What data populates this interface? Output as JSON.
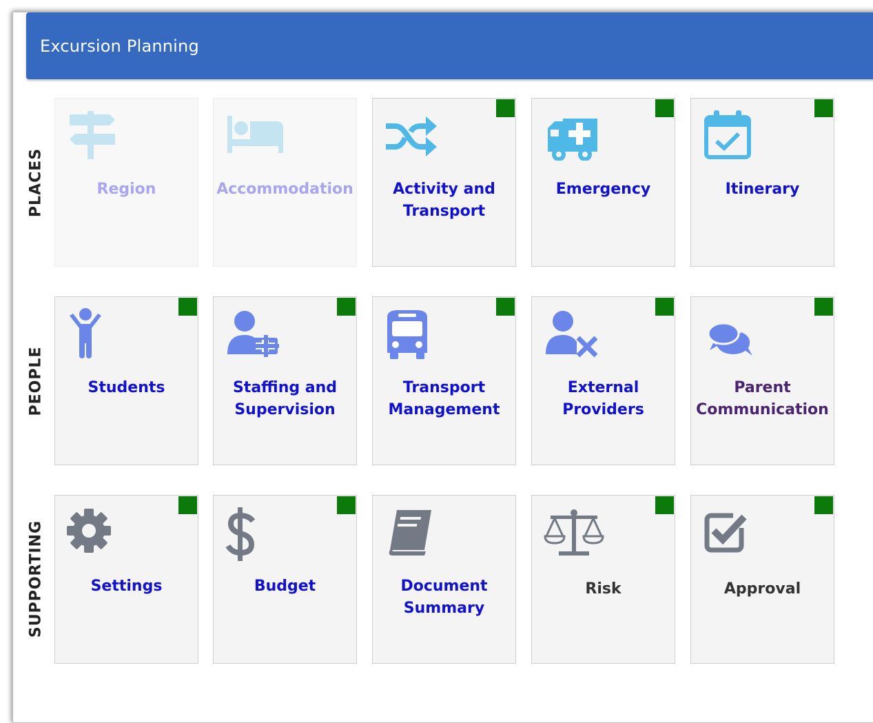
{
  "header": {
    "title": "Excursion Planning"
  },
  "colors": {
    "header_bg": "#356ac0",
    "badge": "#0b7a0b",
    "link": "#1212cc",
    "muted": "#a9a6ef",
    "icon_blue": "#4fb8e6",
    "icon_periwinkle": "#6a86e8",
    "icon_gray": "#737a85"
  },
  "sections": [
    {
      "label": "PLACES",
      "tiles": [
        {
          "label1": "Region",
          "label2": "",
          "icon": "signpost-icon",
          "enabled": false,
          "badge": false
        },
        {
          "label1": "Accommodation",
          "label2": "",
          "icon": "bed-icon",
          "enabled": false,
          "badge": false
        },
        {
          "label1": "Activity and",
          "label2": "Transport",
          "icon": "shuffle-icon",
          "enabled": true,
          "badge": true
        },
        {
          "label1": "Emergency",
          "label2": "",
          "icon": "ambulance-icon",
          "enabled": true,
          "badge": true
        },
        {
          "label1": "Itinerary",
          "label2": "",
          "icon": "calendar-check-icon",
          "enabled": true,
          "badge": true
        }
      ]
    },
    {
      "label": "PEOPLE",
      "tiles": [
        {
          "label1": "Students",
          "label2": "",
          "icon": "child-icon",
          "enabled": true,
          "badge": true
        },
        {
          "label1": "Staffing and",
          "label2": "Supervision",
          "icon": "user-plus-icon",
          "enabled": true,
          "badge": true
        },
        {
          "label1": "Transport",
          "label2": "Management",
          "icon": "bus-icon",
          "enabled": true,
          "badge": true
        },
        {
          "label1": "External",
          "label2": "Providers",
          "icon": "user-times-icon",
          "enabled": true,
          "badge": true
        },
        {
          "label1": "Parent",
          "label2": "Communication",
          "icon": "comments-icon",
          "enabled": true,
          "badge": true
        }
      ]
    },
    {
      "label": "SUPPORTING",
      "tiles": [
        {
          "label1": "Settings",
          "label2": "",
          "icon": "gear-icon",
          "enabled": true,
          "badge": true
        },
        {
          "label1": "Budget",
          "label2": "",
          "icon": "dollar-icon",
          "enabled": true,
          "badge": true
        },
        {
          "label1": "Document",
          "label2": "Summary",
          "icon": "book-icon",
          "enabled": true,
          "badge": false
        },
        {
          "label1": "Risk",
          "label2": "",
          "icon": "scale-icon",
          "enabled": true,
          "badge": true
        },
        {
          "label1": "Approval",
          "label2": "",
          "icon": "checkbox-icon",
          "enabled": true,
          "badge": true
        }
      ]
    }
  ]
}
